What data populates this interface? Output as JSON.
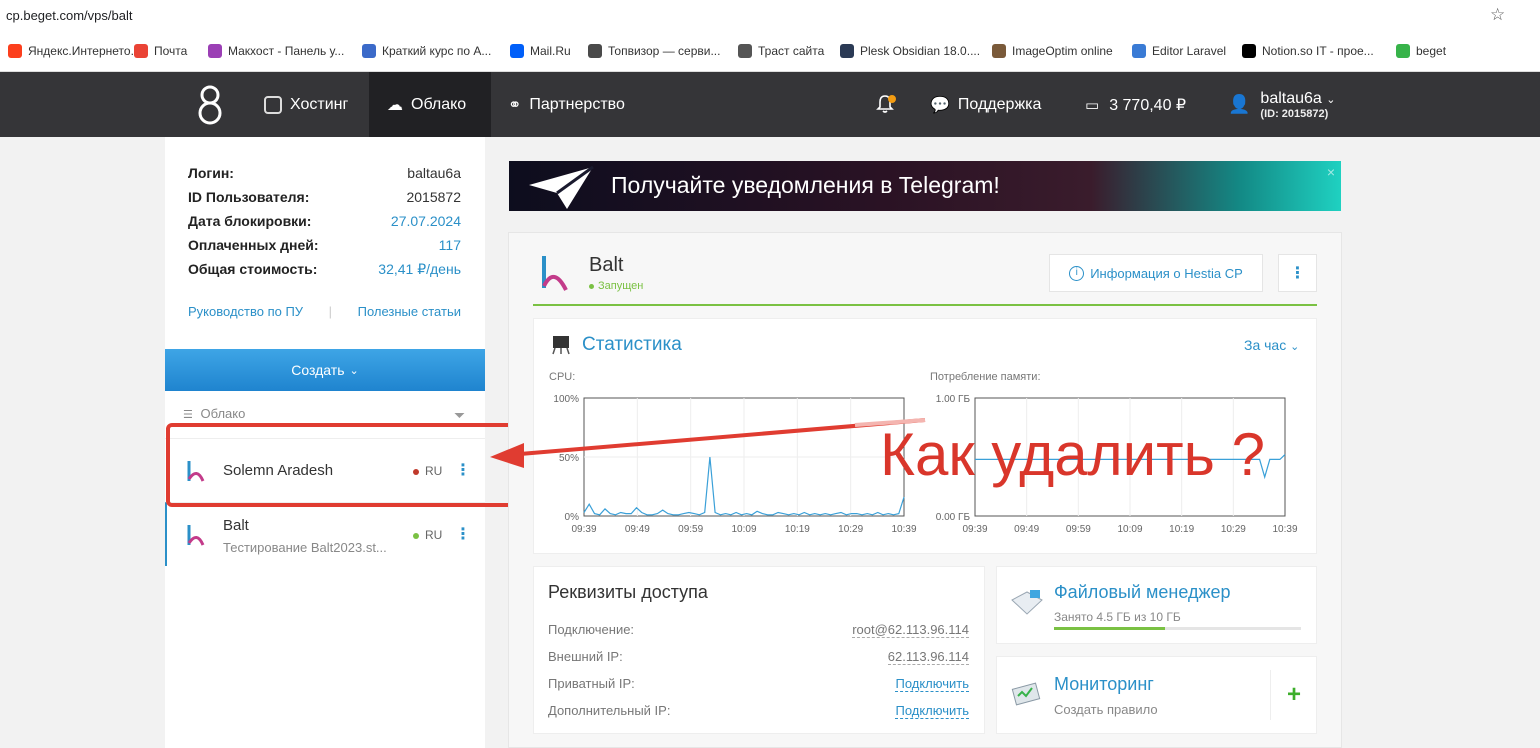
{
  "browser": {
    "url": "cp.beget.com/vps/balt",
    "bookmarks": [
      {
        "label": "Яндекс.Интернето...",
        "icon": "yandex-icon",
        "color": "#fc3f1d"
      },
      {
        "label": "Почта",
        "icon": "gmail-icon",
        "color": "#ea4335"
      },
      {
        "label": "Макхост - Панель у...",
        "icon": "heart-icon",
        "color": "#9b3fb5"
      },
      {
        "label": "Краткий курс по А...",
        "icon": "rocket-icon",
        "color": "#3b6ac9"
      },
      {
        "label": "Mail.Ru",
        "icon": "mail-icon",
        "color": "#005ff9"
      },
      {
        "label": "Топвизор — серви...",
        "icon": "topvisor-icon",
        "color": "#4a4a4a"
      },
      {
        "label": "Траст сайта",
        "icon": "trust-icon",
        "color": "#555555"
      },
      {
        "label": "Plesk Obsidian 18.0....",
        "icon": "plesk-icon",
        "color": "#2b3a55"
      },
      {
        "label": "ImageOptim online",
        "icon": "imageoptim-icon",
        "color": "#7a5a3a"
      },
      {
        "label": "Editor Laravel",
        "icon": "editor-icon",
        "color": "#3a7bd5"
      },
      {
        "label": "Notion.so IT - прое...",
        "icon": "notion-icon",
        "color": "#000000"
      },
      {
        "label": "beget",
        "icon": "beget-icon",
        "color": "#37b34a"
      }
    ]
  },
  "nav": {
    "hosting": "Хостинг",
    "cloud": "Облако",
    "partners": "Партнерство",
    "support": "Поддержка",
    "balance": "3 770,40 ₽",
    "username": "baltau6a",
    "user_id": "(ID: 2015872)"
  },
  "account": {
    "rows": [
      {
        "key": "Логин:",
        "value": "baltau6a",
        "blue": false
      },
      {
        "key": "ID Пользователя:",
        "value": "2015872",
        "blue": false
      },
      {
        "key": "Дата блокировки:",
        "value": "27.07.2024",
        "blue": true
      },
      {
        "key": "Оплаченных дней:",
        "value": "117",
        "blue": true
      },
      {
        "key": "Общая стоимость:",
        "value": "32,41 ₽/день",
        "blue": true
      }
    ],
    "link_guide": "Руководство по ПУ",
    "link_articles": "Полезные статьи",
    "separator": "|"
  },
  "sidebar": {
    "create_label": "Создать",
    "section_label": "Облако",
    "servers": [
      {
        "name": "Solemn Aradesh",
        "subtitle": "",
        "region": "RU",
        "status_color": "#c0392b"
      },
      {
        "name": "Balt",
        "subtitle": "Тестирование Balt2023.st...",
        "region": "RU",
        "status_color": "#7ac143"
      }
    ]
  },
  "banner": {
    "text": "Получайте уведомления в Telegram!",
    "close": "×"
  },
  "vm": {
    "name": "Balt",
    "status": "Запущен",
    "hestia_button": "Информация о Hestia CP"
  },
  "stats": {
    "title": "Статистика",
    "period": "За час"
  },
  "chart_data": [
    {
      "type": "line",
      "title": "CPU:",
      "x": [
        "09:39",
        "09:49",
        "09:59",
        "10:09",
        "10:19",
        "10:29",
        "10:39"
      ],
      "yticks": [
        "100%",
        "50%",
        "0%"
      ],
      "ylim": [
        0,
        100
      ],
      "series": [
        {
          "values": [
            3,
            10,
            2,
            1,
            6,
            2,
            1,
            3,
            2,
            2,
            7,
            3,
            1,
            1,
            2,
            5,
            2,
            1,
            1,
            2,
            3,
            2,
            1,
            3,
            50,
            3,
            1,
            2,
            1,
            3,
            1,
            2,
            1,
            4,
            2,
            1,
            1,
            3,
            2,
            1,
            2,
            1,
            3,
            1,
            2,
            1,
            2,
            1,
            2,
            3,
            1,
            2,
            2,
            1,
            2,
            1,
            3,
            1,
            2,
            1,
            2,
            16
          ]
        }
      ]
    },
    {
      "type": "line",
      "title": "Потребление памяти:",
      "x": [
        "09:39",
        "09:49",
        "09:59",
        "10:09",
        "10:19",
        "10:29",
        "10:39"
      ],
      "yticks": [
        "1.00 ГБ",
        "0.00 ГБ"
      ],
      "ylim": [
        0,
        1
      ],
      "series": [
        {
          "values": [
            0.48,
            0.48,
            0.48,
            0.48,
            0.48,
            0.48,
            0.48,
            0.48,
            0.48,
            0.48,
            0.48,
            0.48,
            0.48,
            0.48,
            0.48,
            0.48,
            0.48,
            0.48,
            0.48,
            0.48,
            0.48,
            0.48,
            0.48,
            0.48,
            0.48,
            0.48,
            0.48,
            0.48,
            0.48,
            0.48,
            0.48,
            0.48,
            0.48,
            0.48,
            0.48,
            0.48,
            0.48,
            0.48,
            0.48,
            0.48,
            0.48,
            0.48,
            0.48,
            0.48,
            0.48,
            0.48,
            0.48,
            0.48,
            0.48,
            0.48,
            0.48,
            0.48,
            0.48,
            0.48,
            0.48,
            0.48,
            0.48,
            0.33,
            0.48,
            0.48,
            0.48,
            0.52
          ]
        }
      ]
    }
  ],
  "annotation": {
    "text": "Как удалить ?"
  },
  "access": {
    "title": "Реквизиты доступа",
    "rows": [
      {
        "key": "Подключение:",
        "value": "root@62.113.96.114",
        "link": false
      },
      {
        "key": "Внешний IP:",
        "value": "62.113.96.114",
        "link": false
      },
      {
        "key": "Приватный IP:",
        "value": "Подключить",
        "link": true
      },
      {
        "key": "Дополнительный IP:",
        "value": "Подключить",
        "link": true
      }
    ]
  },
  "file_manager": {
    "title": "Файловый менеджер",
    "usage": "Занято 4.5 ГБ из 10 ГБ",
    "used_fraction": 0.45
  },
  "monitoring": {
    "title": "Мониторинг",
    "subtitle": "Создать правило",
    "add": "+"
  },
  "colors": {
    "accent": "#2b90c8",
    "ok": "#7ac143",
    "error": "#c0392b",
    "annotation": "#e03c31",
    "nav_bg": "#353538"
  }
}
